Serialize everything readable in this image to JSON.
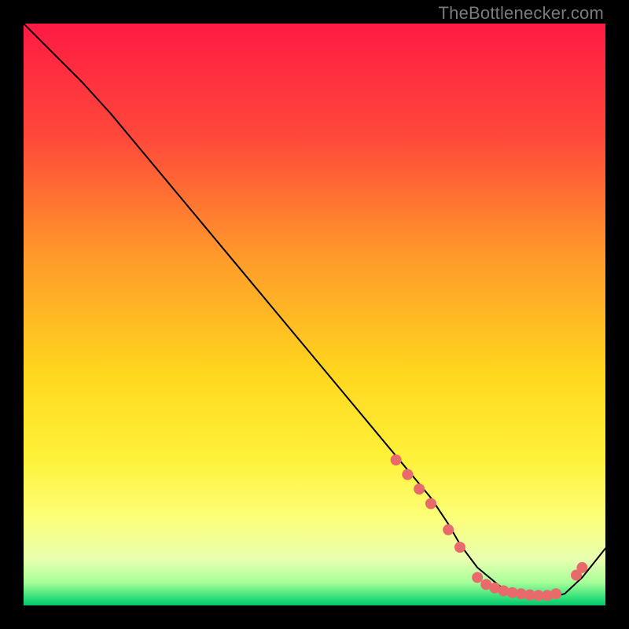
{
  "watermark": "TheBottlenecker.com",
  "chart_data": {
    "type": "line",
    "title": "",
    "xlabel": "",
    "ylabel": "",
    "xlim": [
      0,
      100
    ],
    "ylim": [
      0,
      100
    ],
    "grid": false,
    "legend": false,
    "background": {
      "type": "vertical-gradient",
      "stops": [
        {
          "pos": 0.0,
          "color": "#ff1a44"
        },
        {
          "pos": 0.2,
          "color": "#ff4a3a"
        },
        {
          "pos": 0.4,
          "color": "#ff9a2a"
        },
        {
          "pos": 0.6,
          "color": "#ffd61e"
        },
        {
          "pos": 0.75,
          "color": "#fff23a"
        },
        {
          "pos": 0.85,
          "color": "#fcff7a"
        },
        {
          "pos": 0.92,
          "color": "#e9ffb0"
        },
        {
          "pos": 0.96,
          "color": "#a9ff9a"
        },
        {
          "pos": 0.985,
          "color": "#38e27a"
        },
        {
          "pos": 1.0,
          "color": "#00c96f"
        }
      ]
    },
    "series": [
      {
        "name": "bottleneck-curve",
        "x": [
          0,
          3,
          6,
          10,
          15,
          20,
          30,
          40,
          50,
          60,
          65,
          70,
          73,
          75,
          78,
          82,
          86,
          90,
          93,
          96,
          100
        ],
        "y": [
          100,
          97,
          94,
          90,
          84.5,
          78.5,
          66.5,
          54.5,
          42.5,
          30.5,
          24.5,
          18.5,
          14,
          10.5,
          6.5,
          3.2,
          1.6,
          1.2,
          2.0,
          4.8,
          9.8
        ],
        "stroke": "#000000",
        "stroke_width": 2
      }
    ],
    "markers": {
      "name": "highlight-dots",
      "color": "#e86a6a",
      "radius": 7,
      "points": [
        {
          "x": 64,
          "y": 25
        },
        {
          "x": 66,
          "y": 22.5
        },
        {
          "x": 68,
          "y": 20
        },
        {
          "x": 70,
          "y": 17.5
        },
        {
          "x": 73,
          "y": 13
        },
        {
          "x": 75,
          "y": 10
        },
        {
          "x": 78,
          "y": 4.8
        },
        {
          "x": 79.5,
          "y": 3.6
        },
        {
          "x": 81,
          "y": 3.0
        },
        {
          "x": 82.5,
          "y": 2.5
        },
        {
          "x": 84,
          "y": 2.2
        },
        {
          "x": 85.5,
          "y": 2.0
        },
        {
          "x": 87,
          "y": 1.8
        },
        {
          "x": 88.5,
          "y": 1.7
        },
        {
          "x": 90,
          "y": 1.7
        },
        {
          "x": 91.5,
          "y": 2.0
        },
        {
          "x": 95,
          "y": 5.2
        },
        {
          "x": 96,
          "y": 6.5
        }
      ]
    }
  }
}
